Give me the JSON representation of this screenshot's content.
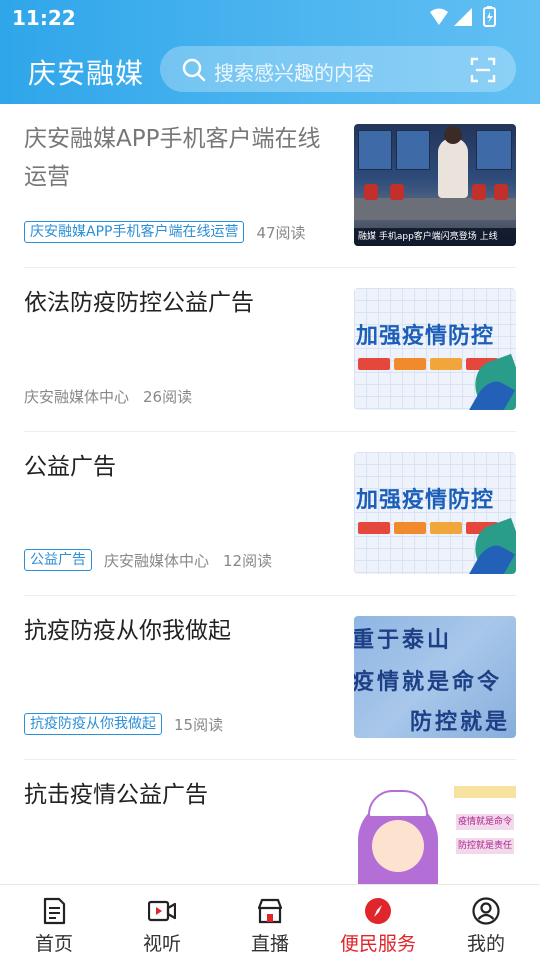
{
  "status_bar": {
    "time": "11:22"
  },
  "header": {
    "app_title": "庆安融媒",
    "search_placeholder": "搜索感兴趣的内容"
  },
  "feed": [
    {
      "title": "庆安融媒APP手机客户端在线运营",
      "tag": "庆安融媒APP手机客户端在线运营",
      "source": "",
      "reads": "47阅读",
      "thumb_caption": "融媒   手机app客户端闪亮登场   上线"
    },
    {
      "title": "依法防疫防控公益广告",
      "tag": "",
      "source": "庆安融媒体中心",
      "reads": "26阅读",
      "thumb_text": "加强疫情防控"
    },
    {
      "title": "公益广告",
      "tag": "公益广告",
      "source": "庆安融媒体中心",
      "reads": "12阅读",
      "thumb_text": "加强疫情防控"
    },
    {
      "title": "抗疫防疫从你我做起",
      "tag": "抗疫防疫从你我做起",
      "source": "",
      "reads": "15阅读",
      "thumb_lines": [
        "重于泰山",
        "疫情就是命令",
        "防控就是"
      ]
    },
    {
      "title": "抗击疫情公益广告",
      "tag": "",
      "source": "",
      "reads": "",
      "thumb_badges": [
        "疫情就是命令",
        "防控就是责任"
      ]
    }
  ],
  "tab_bar": {
    "tabs": [
      {
        "label": "首页",
        "icon": "document-icon"
      },
      {
        "label": "视听",
        "icon": "video-icon"
      },
      {
        "label": "直播",
        "icon": "store-icon"
      },
      {
        "label": "便民服务",
        "icon": "compass-icon"
      },
      {
        "label": "我的",
        "icon": "user-icon"
      }
    ],
    "active_index": 3
  },
  "colors": {
    "header_start": "#2fa6ea",
    "header_end": "#62bff3",
    "accent_blue": "#2b8fd8",
    "active_red": "#e0262b"
  }
}
